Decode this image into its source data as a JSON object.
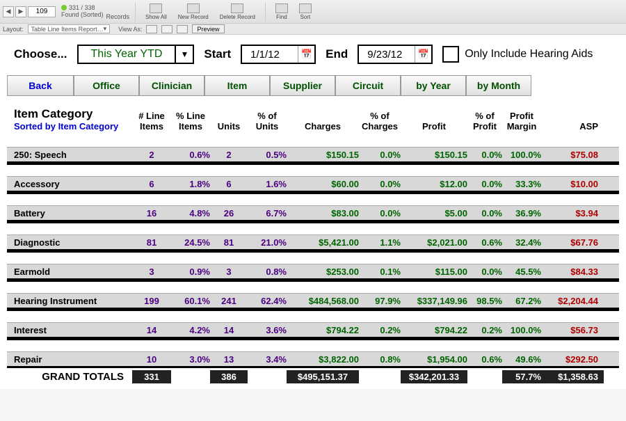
{
  "toolbar": {
    "record_current": "109",
    "found_count": "331 / 338",
    "found_label": "Found (Sorted)",
    "records_label": "Records",
    "show_all": "Show All",
    "new_record": "New Record",
    "delete_record": "Delete Record",
    "find": "Find",
    "sort": "Sort"
  },
  "layoutbar": {
    "layout_label": "Layout:",
    "layout_value": "Table Line Items Report…",
    "viewas_label": "View As:",
    "preview": "Preview"
  },
  "choose": {
    "choose_label": "Choose...",
    "period": "This Year YTD",
    "start_label": "Start",
    "start_date": "1/1/12",
    "end_label": "End",
    "end_date": "9/23/12",
    "only_include": "Only Include Hearing Aids"
  },
  "tabs": {
    "back": "Back",
    "office": "Office",
    "clinician": "Clinician",
    "item": "Item",
    "supplier": "Supplier",
    "circuit": "Circuit",
    "by_year": "by Year",
    "by_month": "by Month"
  },
  "headers": {
    "item_category": "Item Category",
    "sorted_by": "Sorted by Item Category",
    "line_items": "# Line Items",
    "pct_line_items": "% Line Items",
    "units": "Units",
    "pct_units": "% of Units",
    "charges": "Charges",
    "pct_charges": "% of Charges",
    "profit": "Profit",
    "pct_profit": "% of Profit",
    "profit_margin": "Profit Margin",
    "asp": "ASP"
  },
  "rows": [
    {
      "cat": "250: Speech",
      "li": "2",
      "pli": "0.6%",
      "u": "2",
      "pu": "0.5%",
      "ch": "$150.15",
      "pch": "0.0%",
      "pr": "$150.15",
      "ppr": "0.0%",
      "pm": "100.0%",
      "asp": "$75.08"
    },
    {
      "cat": "Accessory",
      "li": "6",
      "pli": "1.8%",
      "u": "6",
      "pu": "1.6%",
      "ch": "$60.00",
      "pch": "0.0%",
      "pr": "$12.00",
      "ppr": "0.0%",
      "pm": "33.3%",
      "asp": "$10.00"
    },
    {
      "cat": "Battery",
      "li": "16",
      "pli": "4.8%",
      "u": "26",
      "pu": "6.7%",
      "ch": "$83.00",
      "pch": "0.0%",
      "pr": "$5.00",
      "ppr": "0.0%",
      "pm": "36.9%",
      "asp": "$3.94"
    },
    {
      "cat": "Diagnostic",
      "li": "81",
      "pli": "24.5%",
      "u": "81",
      "pu": "21.0%",
      "ch": "$5,421.00",
      "pch": "1.1%",
      "pr": "$2,021.00",
      "ppr": "0.6%",
      "pm": "32.4%",
      "asp": "$67.76"
    },
    {
      "cat": "Earmold",
      "li": "3",
      "pli": "0.9%",
      "u": "3",
      "pu": "0.8%",
      "ch": "$253.00",
      "pch": "0.1%",
      "pr": "$115.00",
      "ppr": "0.0%",
      "pm": "45.5%",
      "asp": "$84.33"
    },
    {
      "cat": "Hearing Instrument",
      "li": "199",
      "pli": "60.1%",
      "u": "241",
      "pu": "62.4%",
      "ch": "$484,568.00",
      "pch": "97.9%",
      "pr": "$337,149.96",
      "ppr": "98.5%",
      "pm": "67.2%",
      "asp": "$2,204.44"
    },
    {
      "cat": "Interest",
      "li": "14",
      "pli": "4.2%",
      "u": "14",
      "pu": "3.6%",
      "ch": "$794.22",
      "pch": "0.2%",
      "pr": "$794.22",
      "ppr": "0.2%",
      "pm": "100.0%",
      "asp": "$56.73"
    },
    {
      "cat": "Repair",
      "li": "10",
      "pli": "3.0%",
      "u": "13",
      "pu": "3.4%",
      "ch": "$3,822.00",
      "pch": "0.8%",
      "pr": "$1,954.00",
      "ppr": "0.6%",
      "pm": "49.6%",
      "asp": "$292.50"
    }
  ],
  "grand": {
    "label": "GRAND TOTALS",
    "li": "331",
    "u": "386",
    "ch": "$495,151.37",
    "pr": "$342,201.33",
    "pm": "57.7%",
    "asp": "$1,358.63"
  }
}
